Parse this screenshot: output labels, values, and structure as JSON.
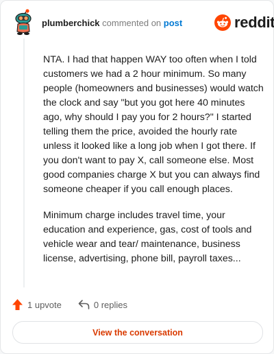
{
  "header": {
    "username": "plumberchick",
    "action_text": "commented on",
    "post_link": "post",
    "logo_text": "reddit",
    "avatar_icon": "snoo-avatar-icon",
    "logo_icon": "reddit-snoo-icon"
  },
  "comment": {
    "paragraphs": [
      "NTA. I had that happen WAY too often when I told customers we had a 2 hour minimum. So many people (homeowners and businesses) would watch the clock and say \"but you got here 40 minutes ago, why should I pay you for 2 hours?\" I started telling them the price, avoided the hourly rate unless it looked like a long job when I got there. If you don't want to pay X, call someone else. Most good companies charge X but you can always find someone cheaper if you call enough places.",
      "Minimum charge includes travel time, your education and experience, gas, cost of tools and vehicle wear and tear/ maintenance, business license, advertising, phone bill, payroll taxes..."
    ]
  },
  "actions": {
    "upvote_label": "1 upvote",
    "upvote_icon": "upvote-arrow-icon",
    "replies_label": "0 replies",
    "reply_icon": "reply-arrow-icon"
  },
  "cta": {
    "label": "View the conversation"
  },
  "colors": {
    "accent": "#ff4500",
    "link": "#0079d3",
    "cta_text": "#d93a00",
    "avatar_teal": "#2a9d96"
  }
}
